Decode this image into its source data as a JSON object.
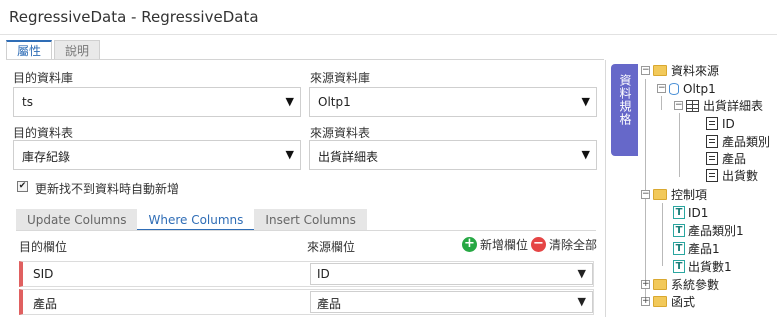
{
  "app": {
    "title": "RegressiveData - RegressiveData"
  },
  "tabs": [
    {
      "label": "屬性",
      "active": true
    },
    {
      "label": "說明",
      "active": false
    }
  ],
  "form": {
    "target_db_label": "目的資料庫",
    "target_db_value": "ts",
    "source_db_label": "來源資料庫",
    "source_db_value": "Oltp1",
    "target_table_label": "目的資料表",
    "target_table_value": "庫存紀錄",
    "source_table_label": "來源資料表",
    "source_table_value": "出貨詳細表",
    "auto_insert_label": "更新找不到資料時自動新增",
    "auto_insert_checked": true
  },
  "column_tabs": [
    {
      "label": "Update Columns",
      "active": false
    },
    {
      "label": "Where Columns",
      "active": true
    },
    {
      "label": "Insert Columns",
      "active": false
    }
  ],
  "columns": {
    "target_header": "目的欄位",
    "source_header": "來源欄位",
    "add_label": "新增欄位",
    "clear_label": "清除全部",
    "rows": [
      {
        "target": "SID",
        "source": "ID"
      },
      {
        "target": "產品",
        "source": "產品"
      }
    ]
  },
  "side_tab": {
    "label": "資料規格"
  },
  "tree": {
    "data_source": "資料來源",
    "db": "Oltp1",
    "table": "出貨詳細表",
    "fields": [
      "ID",
      "產品類別",
      "產品",
      "出貨數"
    ],
    "controls": "控制項",
    "control_items": [
      "ID1",
      "產品類別1",
      "產品1",
      "出貨數1"
    ],
    "system_params": "系統參數",
    "functions": "函式"
  },
  "icons": {
    "dropdown": "▼",
    "check": "✔",
    "expand": "+",
    "collapse": "−",
    "add": "+",
    "remove": "−",
    "text_control": "T"
  },
  "colors": {
    "accent": "#2f6db6",
    "side_tab": "#6668c9",
    "row_marker": "#e06060",
    "add_green": "#27a844",
    "clear_red": "#e54545"
  }
}
